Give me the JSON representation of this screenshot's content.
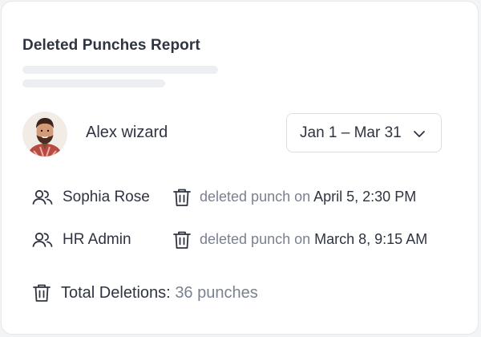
{
  "card": {
    "title": "Deleted Punches Report"
  },
  "user": {
    "name": "Alex wizard",
    "avatar_icon": "person-photo-avatar"
  },
  "date_range": {
    "value": "Jan 1 – Mar 31",
    "icon": "chevron-down-icon"
  },
  "events": [
    {
      "actor": "Sophia Rose",
      "actor_icon": "users-icon",
      "action_icon": "trash-icon",
      "action_text": "deleted punch on",
      "datetime": "April 5, 2:30 PM"
    },
    {
      "actor": "HR Admin",
      "actor_icon": "users-icon",
      "action_icon": "trash-icon",
      "action_text": "deleted punch on",
      "datetime": "March 8, 9:15 AM"
    }
  ],
  "summary": {
    "label": "Total Deletions:",
    "value": "36 punches",
    "icon": "trash-icon"
  },
  "colors": {
    "text_primary": "#2f3441",
    "text_muted": "#7a818f",
    "border": "#dcdee3",
    "skeleton": "#eceef1"
  }
}
